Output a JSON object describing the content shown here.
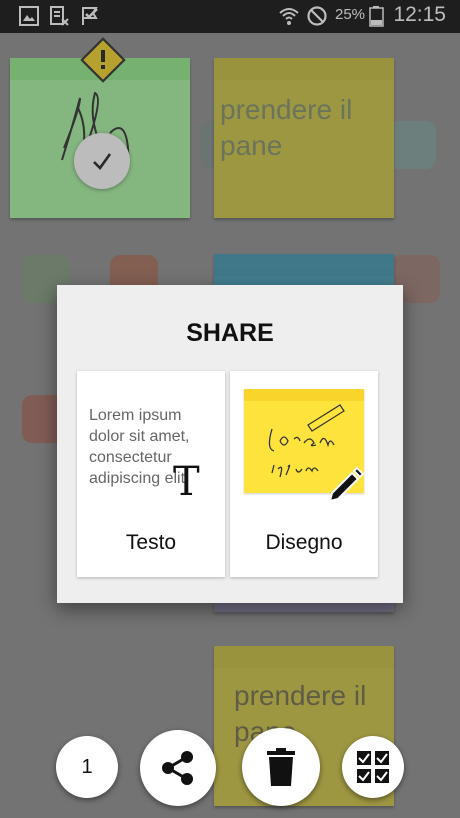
{
  "status_bar": {
    "battery_percent": "25%",
    "time": "12:15",
    "icons": [
      "gallery-icon",
      "sim-blocked-icon",
      "check-flag-icon",
      "wifi-icon",
      "do-not-disturb-icon",
      "battery-icon"
    ]
  },
  "notes": {
    "note2_text": "prendere il pane",
    "note_bottom_text": "prendere il pane",
    "colors": {
      "green": "#a5f59d",
      "green_band": "#8eee85",
      "yellow": "#cfc43a",
      "yellow_band": "#c8bd35",
      "blue": "#3d9bb8",
      "lavender": "#8c84a6"
    }
  },
  "dialog": {
    "title": "SHARE",
    "options": [
      {
        "label": "Testo",
        "preview_text": "Lorem ipsum dolor sit amet, consectetur adipiscing elit,",
        "icon": "text-t-icon"
      },
      {
        "label": "Disegno",
        "preview_text": "lorem ipsum",
        "icon": "pencil-icon"
      }
    ]
  },
  "bottom_bar": {
    "selected_count": "1",
    "buttons": [
      "share-icon",
      "trash-icon",
      "select-all-icon"
    ]
  },
  "accent_colors": {
    "warning": "#f7d31b",
    "sticky_yellow": "#fde33c"
  }
}
